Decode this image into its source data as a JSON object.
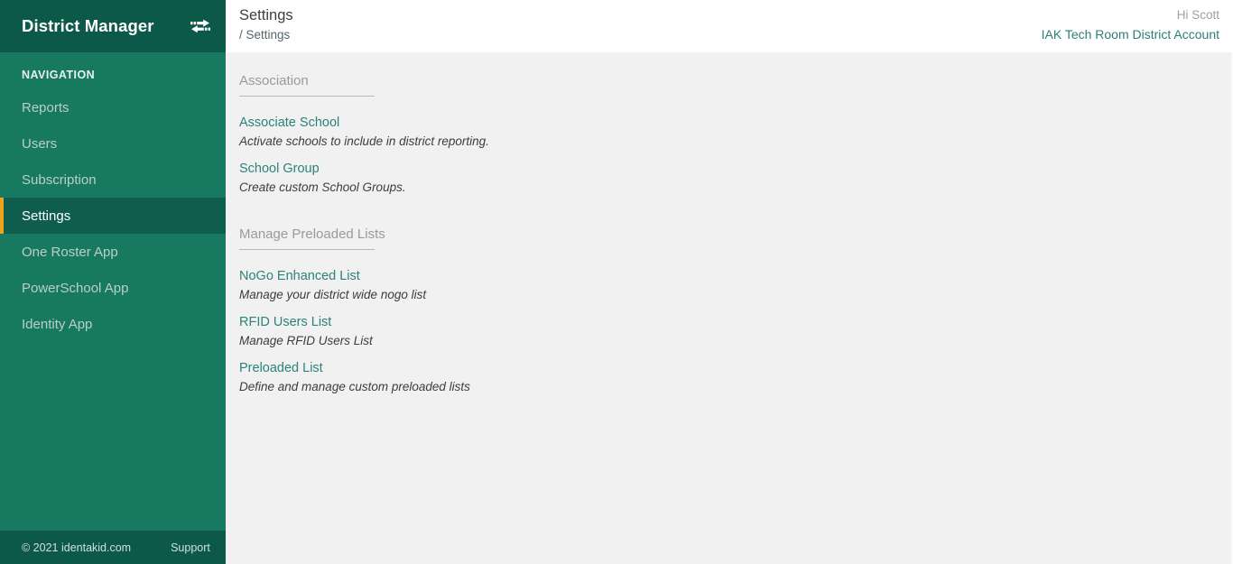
{
  "brand": {
    "title": "District Manager",
    "toggle_icon": "exchange-arrows-icon"
  },
  "sidebar": {
    "nav_label": "NAVIGATION",
    "items": [
      {
        "label": "Reports",
        "active": false
      },
      {
        "label": "Users",
        "active": false
      },
      {
        "label": "Subscription",
        "active": false
      },
      {
        "label": "Settings",
        "active": true
      },
      {
        "label": "One Roster App",
        "active": false
      },
      {
        "label": "PowerSchool App",
        "active": false
      },
      {
        "label": "Identity App",
        "active": false
      }
    ],
    "footer": {
      "copyright": "© 2021 identakid.com",
      "support_label": "Support"
    }
  },
  "topbar": {
    "page_title": "Settings",
    "breadcrumb": "/ Settings",
    "greeting": "Hi Scott",
    "account_name": "IAK Tech Room District Account"
  },
  "content": {
    "groups": [
      {
        "heading": "Association",
        "entries": [
          {
            "link": "Associate School",
            "desc": "Activate schools to include in district reporting."
          },
          {
            "link": "School Group",
            "desc": "Create custom School Groups."
          }
        ]
      },
      {
        "heading": "Manage Preloaded Lists",
        "entries": [
          {
            "link": "NoGo Enhanced List",
            "desc": "Manage your district wide nogo list"
          },
          {
            "link": "RFID Users List",
            "desc": "Manage RFID Users List"
          },
          {
            "link": "Preloaded List",
            "desc": "Define and manage custom preloaded lists"
          }
        ]
      }
    ]
  },
  "colors": {
    "sidebar_bg": "#177a60",
    "sidebar_dark": "#0c5849",
    "sidebar_active_bg": "#0f5e4d",
    "accent_orange": "#efa31d",
    "link_teal": "#2b8379",
    "account_teal": "#2c7f75",
    "content_bg": "#f1f1f1"
  }
}
